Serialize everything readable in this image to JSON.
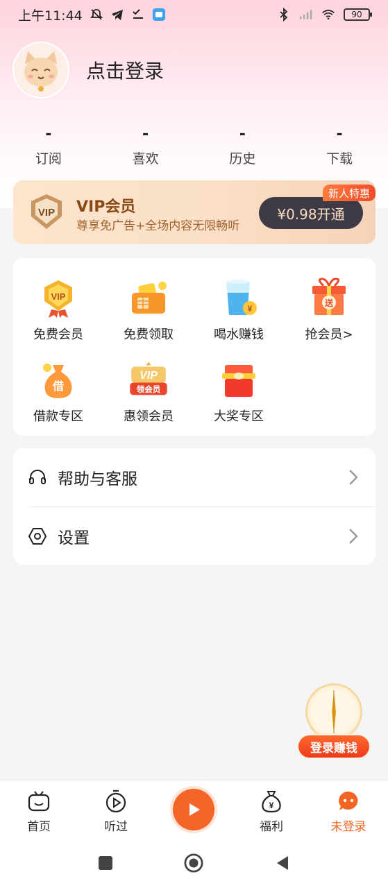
{
  "status_bar": {
    "time": "上午11:44",
    "battery": "90",
    "icons": [
      "mute-bell-icon",
      "telegram-icon",
      "check-icon",
      "app-icon",
      "bluetooth-icon",
      "signal-icon",
      "wifi-icon",
      "battery-icon"
    ]
  },
  "profile": {
    "avatar_icon": "cat-avatar-icon",
    "login_text": "点击登录"
  },
  "stats": [
    {
      "value": "-",
      "label": "订阅"
    },
    {
      "value": "-",
      "label": "喜欢"
    },
    {
      "value": "-",
      "label": "历史"
    },
    {
      "value": "-",
      "label": "下载"
    }
  ],
  "vip": {
    "badge_text": "VIP",
    "title": "VIP会员",
    "subtitle": "尊享免广告+全场内容无限畅听",
    "button": "¥0.98开通",
    "tag": "新人特惠"
  },
  "grid": [
    {
      "label": "免费会员",
      "icon": "vip-medal-icon"
    },
    {
      "label": "免费领取",
      "icon": "wallet-card-icon"
    },
    {
      "label": "喝水赚钱",
      "icon": "water-cup-icon"
    },
    {
      "label": "抢会员>",
      "icon": "gift-box-icon"
    },
    {
      "label": "借款专区",
      "icon": "money-bag-icon"
    },
    {
      "label": "惠领会员",
      "icon": "vip-ribbon-icon"
    },
    {
      "label": "大奖专区",
      "icon": "red-chest-icon"
    }
  ],
  "grid_icon_text": {
    "vip": "VIP",
    "send": "送",
    "borrow": "借",
    "vip2": "VIP",
    "lingvip": "领会员",
    "yen": "¥"
  },
  "menu": [
    {
      "label": "帮助与客服",
      "icon": "headset-icon"
    },
    {
      "label": "设置",
      "icon": "settings-hexagon-icon"
    }
  ],
  "float": {
    "button": "登录赚钱"
  },
  "tabs": [
    {
      "label": "首页",
      "icon": "tv-icon"
    },
    {
      "label": "听过",
      "icon": "timer-play-icon"
    },
    {
      "label": "",
      "icon": "play-icon"
    },
    {
      "label": "福利",
      "icon": "money-bag-yen-icon",
      "icon_text": "¥"
    },
    {
      "label": "未登录",
      "icon": "chat-face-icon"
    }
  ],
  "colors": {
    "accent": "#f26522",
    "vip_dark": "#3f3b46",
    "vip_gold": "#8a4a16"
  }
}
